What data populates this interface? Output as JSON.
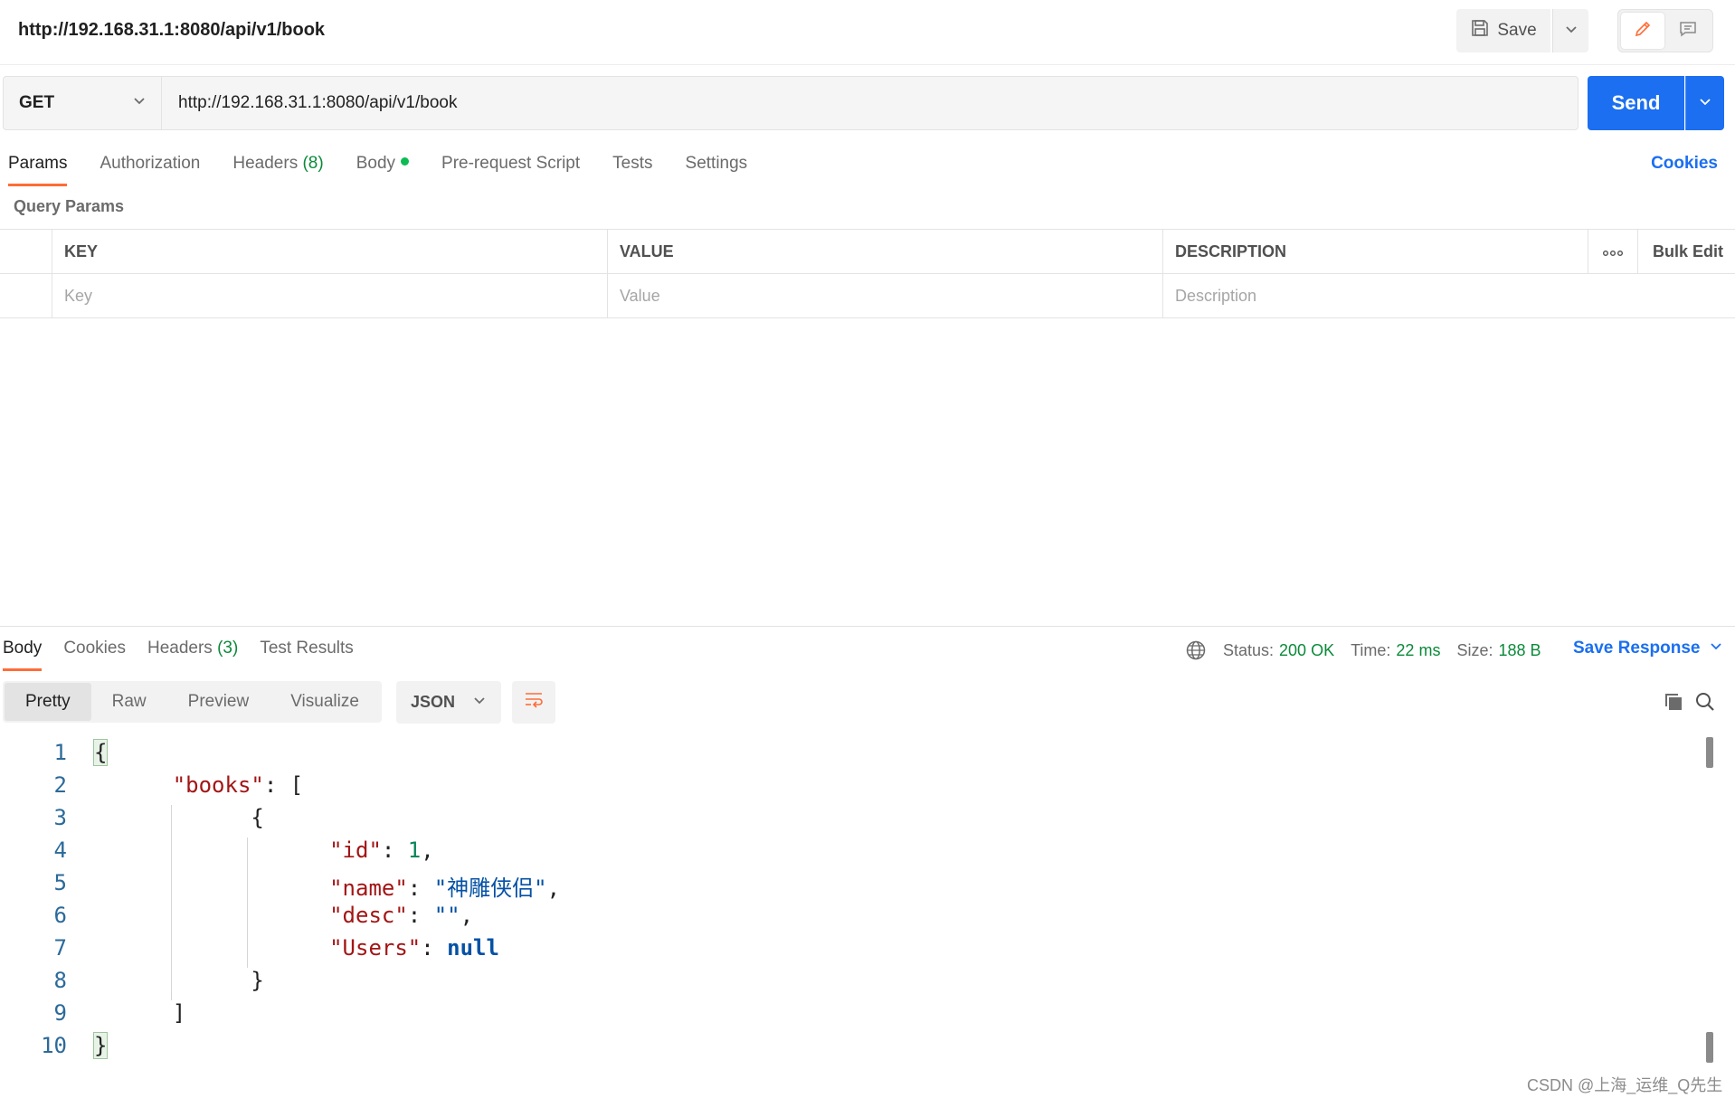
{
  "title_bar": {
    "title": "http://192.168.31.1:8080/api/v1/book",
    "save_label": "Save"
  },
  "request": {
    "method": "GET",
    "url": "http://192.168.31.1:8080/api/v1/book",
    "send_label": "Send"
  },
  "request_tabs": [
    {
      "label": "Params",
      "active": true
    },
    {
      "label": "Authorization"
    },
    {
      "label": "Headers",
      "count": "(8)"
    },
    {
      "label": "Body",
      "dot": true
    },
    {
      "label": "Pre-request Script"
    },
    {
      "label": "Tests"
    },
    {
      "label": "Settings"
    }
  ],
  "cookies_label": "Cookies",
  "params": {
    "section_label": "Query Params",
    "columns": {
      "key": "KEY",
      "value": "VALUE",
      "description": "DESCRIPTION",
      "bulk_edit": "Bulk Edit"
    },
    "placeholders": {
      "key": "Key",
      "value": "Value",
      "description": "Description"
    }
  },
  "response": {
    "tabs": [
      {
        "label": "Body",
        "active": true
      },
      {
        "label": "Cookies"
      },
      {
        "label": "Headers",
        "count": "(3)"
      },
      {
        "label": "Test Results"
      }
    ],
    "status_label": "Status:",
    "status_value": "200 OK",
    "time_label": "Time:",
    "time_value": "22 ms",
    "size_label": "Size:",
    "size_value": "188 B",
    "save_response_label": "Save Response",
    "views": [
      "Pretty",
      "Raw",
      "Preview",
      "Visualize"
    ],
    "active_view": "Pretty",
    "format": "JSON",
    "code_lines": [
      "1",
      "2",
      "3",
      "4",
      "5",
      "6",
      "7",
      "8",
      "9",
      "10"
    ],
    "body": {
      "key_books": "\"books\"",
      "key_id": "\"id\"",
      "val_id": "1",
      "key_name": "\"name\"",
      "val_name": "\"神雕侠侣\"",
      "key_desc": "\"desc\"",
      "val_desc": "\"\"",
      "key_users": "\"Users\"",
      "val_users": "null"
    }
  },
  "watermark": "CSDN @上海_运维_Q先生",
  "colors": {
    "accent": "#ff6c37",
    "primary": "#1b6ff0",
    "success": "#0b8a3a"
  },
  "icons": [
    "save-icon",
    "chevron-down-icon",
    "pencil-icon",
    "comment-icon",
    "globe-icon",
    "wrap-lines-icon",
    "copy-icon",
    "search-icon",
    "more-icon"
  ]
}
